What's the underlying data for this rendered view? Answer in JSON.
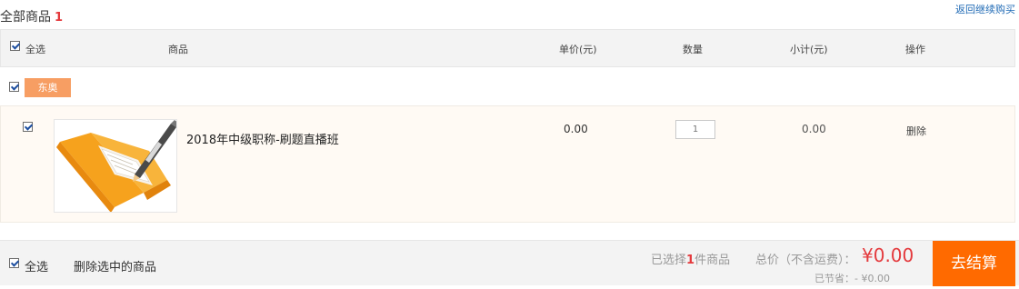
{
  "header": {
    "title": "全部商品",
    "count": "1",
    "back_link": "返回继续购买"
  },
  "table_header": {
    "select_all": "全选",
    "product": "商品",
    "unit_price": "单价(元)",
    "quantity": "数量",
    "subtotal": "小计(元)",
    "action": "操作"
  },
  "shop": {
    "name": "东奥"
  },
  "items": [
    {
      "name": "2018年中级职称-刷题直播班",
      "price": "0.00",
      "quantity": "1",
      "subtotal": "0.00",
      "delete": "删除"
    }
  ],
  "footer": {
    "select_all": "全选",
    "delete_selected": "删除选中的商品",
    "selected_prefix": "已选择",
    "selected_count": "1",
    "selected_suffix": "件商品",
    "total_label": "总价（不含运费）：",
    "total_value": "¥0.00",
    "saved_text": "已节省：- ¥0.00",
    "checkout": "去结算"
  },
  "colors": {
    "accent_orange": "#ff6a00",
    "shop_tag": "#f79e63",
    "price_red": "#e4393c",
    "link_blue": "#1f6ab5"
  },
  "icons": [
    "checkbox-icon",
    "book-pen-thumbnail"
  ]
}
